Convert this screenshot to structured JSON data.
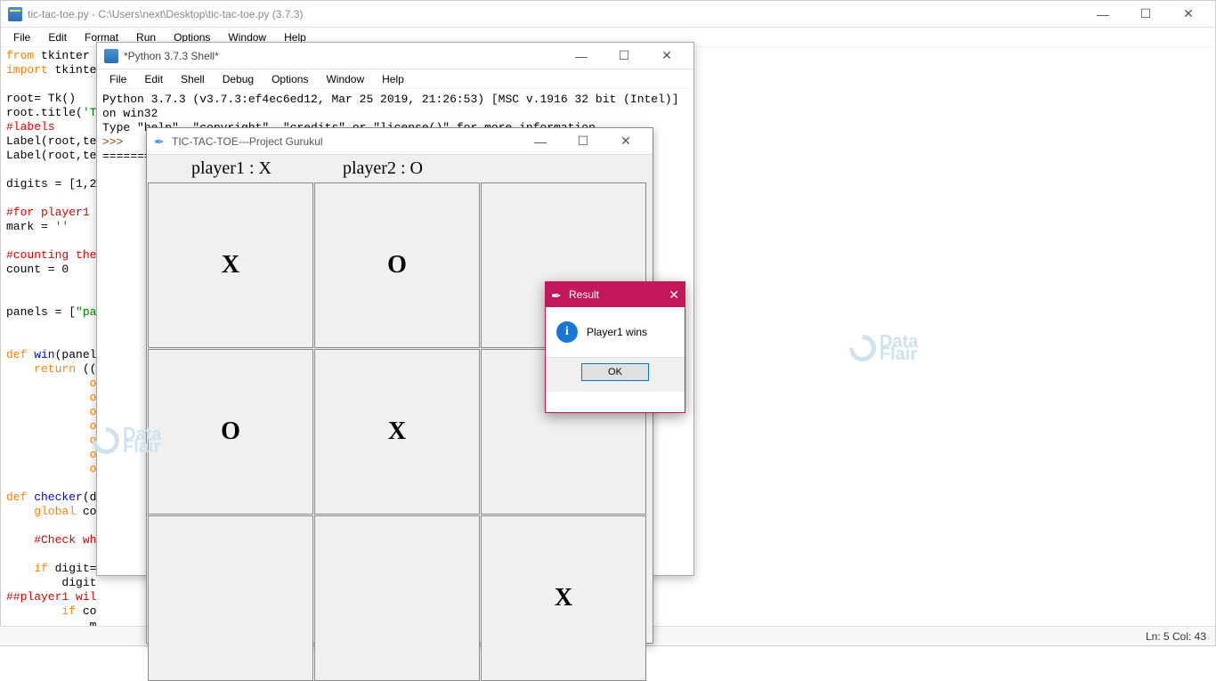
{
  "main": {
    "title": "tic-tac-toe.py - C:\\Users\\next\\Desktop\\tic-tac-toe.py (3.7.3)",
    "menu": [
      "File",
      "Edit",
      "Format",
      "Run",
      "Options",
      "Window",
      "Help"
    ],
    "code": {
      "l1a": "from",
      "l1b": " tkinter ",
      "l2a": "import",
      "l2b": " tkinte",
      "l3": "",
      "l4": "root= Tk()",
      "l5a": "root.title(",
      "l5b": "'T",
      "l6": "#labels",
      "l7": "Label(root,te",
      "l8": "Label(root,te",
      "l9": "",
      "l10": "digits = [1,2",
      "l11": "",
      "l12": "#for player1",
      "l13a": "mark = ",
      "l13b": "''",
      "l14": "",
      "l15": "#counting the",
      "l16": "count = 0",
      "l17": "",
      "l18": "",
      "l19a": "panels = [",
      "l19b": "\"pa",
      "l20": "",
      "l21": "",
      "l22a": "def",
      "l22b": " win",
      "l22c": "(panel",
      "l23a": "    return",
      "l23b": " ((",
      "l24": "            o",
      "l25": "            o",
      "l26": "            o",
      "l27": "            o",
      "l28": "            o",
      "l29": "            o",
      "l30": "            o",
      "l31": "",
      "l32a": "def",
      "l32b": " checker",
      "l32c": "(d",
      "l33a": "    global",
      "l33b": " co",
      "l34": "",
      "l35": "    #Check wh",
      "l36": "",
      "l37a": "    if",
      "l37b": " digit=",
      "l38": "        digit",
      "l39": "##player1 wil",
      "l40a": "        if",
      "l40b": " co",
      "l41": "            m"
    },
    "status": "Ln: 5  Col: 43"
  },
  "shell": {
    "title": "*Python 3.7.3 Shell*",
    "menu": [
      "File",
      "Edit",
      "Shell",
      "Debug",
      "Options",
      "Window",
      "Help"
    ],
    "line1": "Python 3.7.3 (v3.7.3:ef4ec6ed12, Mar 25 2019, 21:26:53) [MSC v.1916 32 bit (Intel)] on win32",
    "line2": "Type \"help\", \"copyright\", \"credits\" or \"license()\" for more information.",
    "prompt": ">>>",
    "sep": "========"
  },
  "game": {
    "title": "TIC-TAC-TOE---Project Gurukul",
    "label1": "player1 : X",
    "label2": "player2 : O",
    "cells": [
      "X",
      "O",
      "",
      "O",
      "X",
      "",
      "",
      "",
      "X"
    ]
  },
  "dialog": {
    "title": "Result",
    "message": "Player1 wins",
    "ok": "OK"
  },
  "win_controls": {
    "min": "—",
    "max": "☐",
    "close": "✕"
  },
  "watermark": {
    "t1": "Data",
    "t2": "Flair"
  }
}
